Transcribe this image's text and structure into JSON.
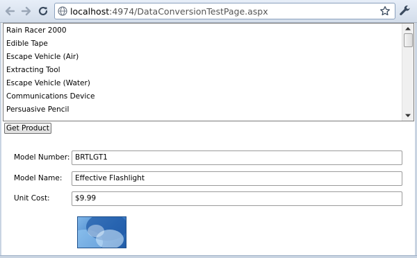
{
  "browser": {
    "url_host": "localhost",
    "url_rest": ":4974/DataConversionTestPage.aspx"
  },
  "products_list": {
    "items": [
      "Rain Racer 2000",
      "Edible Tape",
      "Escape Vehicle (Air)",
      "Extracting Tool",
      "Escape Vehicle (Water)",
      "Communications Device",
      "Persuasive Pencil"
    ]
  },
  "get_product_label": "Get Product",
  "form": {
    "model_number_label": "Model Number:",
    "model_number_value": "BRTLGT1",
    "model_name_label": "Model Name:",
    "model_name_value": "Effective Flashlight",
    "unit_cost_label": "Unit Cost:",
    "unit_cost_value": "$9.99"
  },
  "colors": {
    "chrome_top": "#e7eef8",
    "chrome_bottom": "#d3ddea",
    "url_border": "#8aa0bd"
  }
}
